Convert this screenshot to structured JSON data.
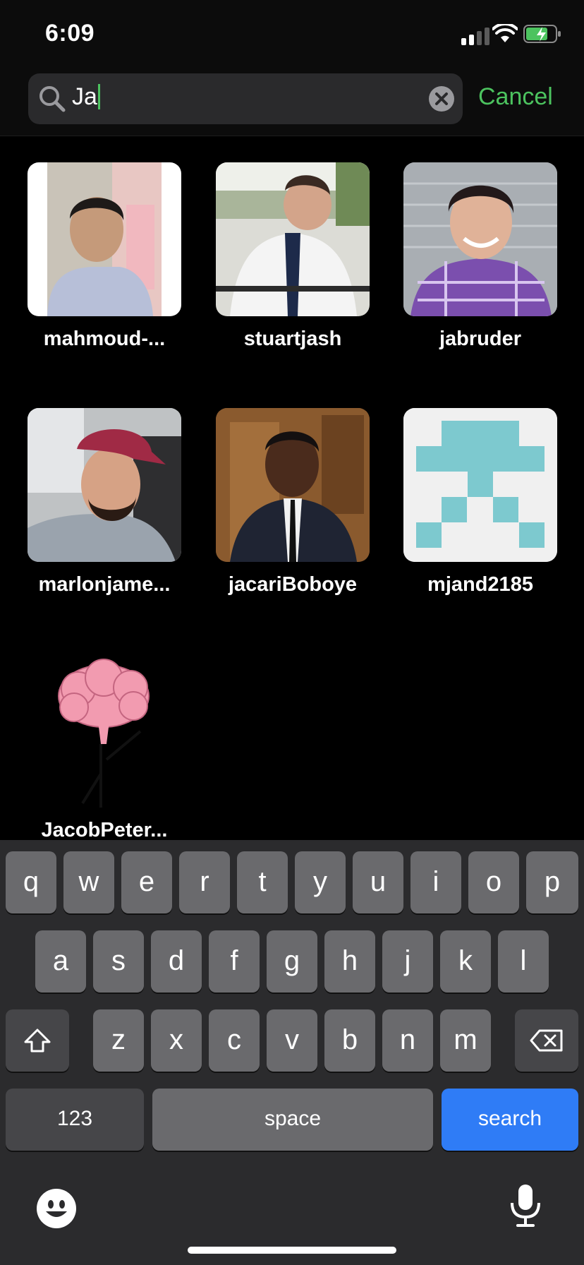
{
  "status": {
    "time": "6:09",
    "signal_icon": "cellular-signal-icon",
    "wifi_icon": "wifi-icon",
    "battery_icon": "battery-charging-icon"
  },
  "search": {
    "query": "Ja",
    "cancel_label": "Cancel"
  },
  "results": [
    {
      "username": "mahmoud-..."
    },
    {
      "username": "stuartjash"
    },
    {
      "username": "jabruder"
    },
    {
      "username": "marlonjame..."
    },
    {
      "username": "jacariBoboye"
    },
    {
      "username": "mjand2185"
    },
    {
      "username": "JacobPeter..."
    }
  ],
  "keyboard": {
    "row1": [
      "q",
      "w",
      "e",
      "r",
      "t",
      "y",
      "u",
      "i",
      "o",
      "p"
    ],
    "row2": [
      "a",
      "s",
      "d",
      "f",
      "g",
      "h",
      "j",
      "k",
      "l"
    ],
    "row3": [
      "z",
      "x",
      "c",
      "v",
      "b",
      "n",
      "m"
    ],
    "numbers_label": "123",
    "space_label": "space",
    "search_label": "search"
  },
  "colors": {
    "accent": "#4cc35f",
    "search_key": "#2f7cf6"
  }
}
